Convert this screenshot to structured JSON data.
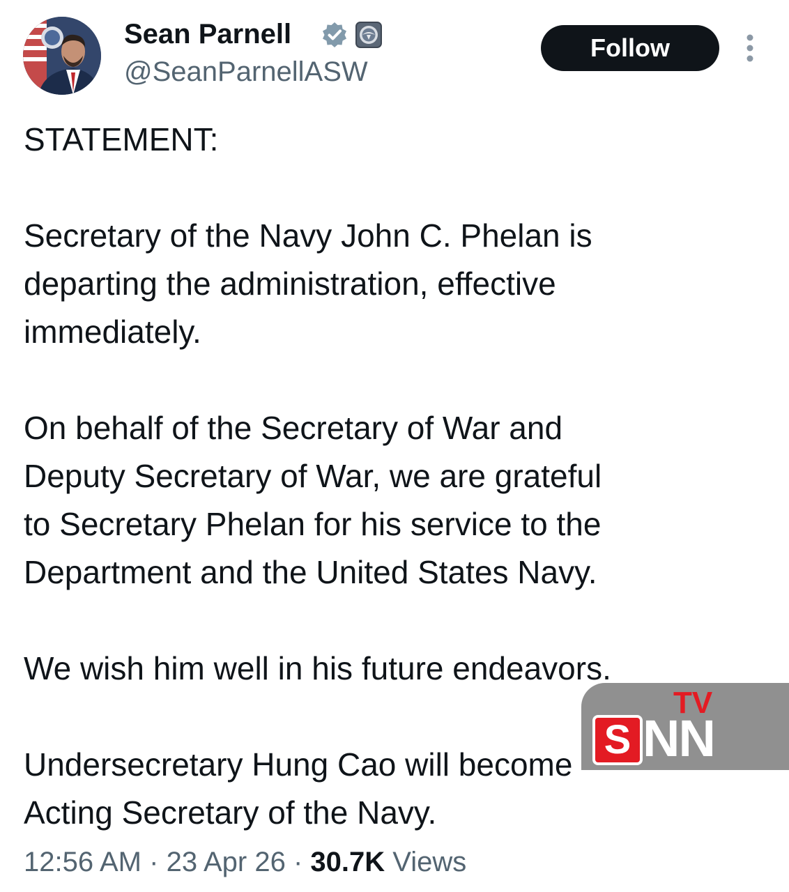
{
  "author": {
    "name": "Sean Parnell",
    "handle": "@SeanParnellASW"
  },
  "icons": {
    "verified": "verified-badge-icon",
    "affiliation": "department-seal-icon",
    "more": "more-options-icon"
  },
  "follow_label": "Follow",
  "tweet": {
    "text": "STATEMENT:\n\nSecretary of the Navy John C. Phelan is\ndeparting the administration, effective\nimmediately.\n\nOn behalf of the Secretary of War and\nDeputy Secretary of War, we are grateful\nto Secretary Phelan for his service to the\nDepartment and the United States Navy.\n\nWe wish him well in his future endeavors.\n\nUndersecretary Hung Cao will become\nActing Secretary of the Navy.",
    "time": "12:56 AM",
    "date": "23 Apr 26",
    "views_count": "30.7K",
    "views_label": "Views"
  },
  "watermark": {
    "s": "S",
    "nn": "NN",
    "tv": "TV"
  },
  "colors": {
    "text": "#0f1419",
    "secondary": "#536471",
    "follow_bg": "#0f1419",
    "watermark_red": "#e31b23"
  }
}
